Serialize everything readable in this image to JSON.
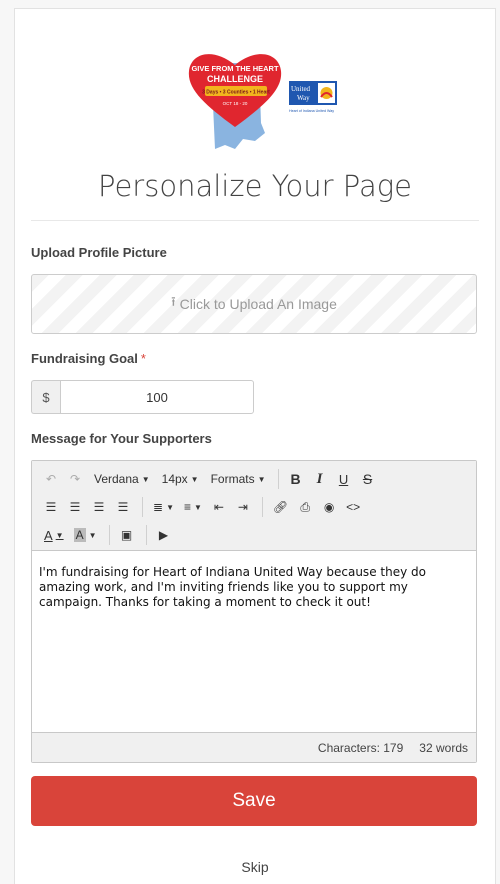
{
  "logo": {
    "heart_line1": "GIVE FROM THE HEART",
    "heart_line2": "CHALLENGE",
    "banner": "3 Days • 3 Counties • 1 Heart",
    "dates": "OCT 18 - 20",
    "uw_name1": "United",
    "uw_name2": "Way",
    "uw_sub": "Heart of Indiana United Way",
    "colors": {
      "heart": "#e0262f",
      "state": "#8ab4e0",
      "uw_blue": "#1f57b0",
      "banner": "#f2b51d"
    }
  },
  "page": {
    "title": "Personalize Your Page"
  },
  "upload": {
    "label": "Upload Profile Picture",
    "button_text": "Click to Upload An Image",
    "icon": "upload-icon"
  },
  "goal": {
    "label": "Fundraising Goal",
    "required_mark": "*",
    "prefix": "$",
    "value": "100"
  },
  "message": {
    "label": "Message for Your Supporters",
    "toolbar": {
      "font": "Verdana",
      "size": "14px",
      "formats": "Formats",
      "bold": "B",
      "italic": "I",
      "underline": "U",
      "strike": "S"
    },
    "text": "I'm fundraising for Heart of Indiana United Way because they do amazing work, and I'm inviting friends like you to support my campaign. Thanks for taking a moment to check it out!",
    "char_count": "Characters: 179",
    "word_count": "32 words"
  },
  "actions": {
    "save": "Save",
    "skip": "Skip"
  },
  "colors": {
    "primary": "#d9443a"
  }
}
